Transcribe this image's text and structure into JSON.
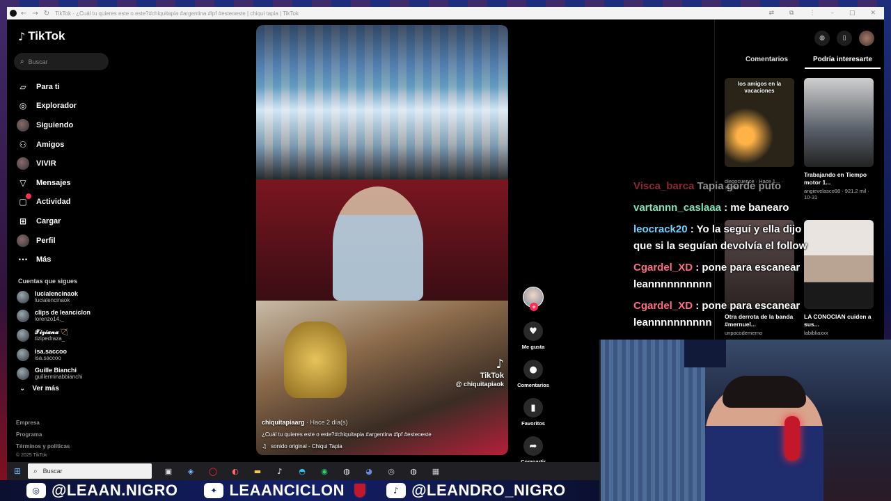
{
  "browser": {
    "tab_title": "TikTok - ¿Cuál tu quieres este o este?#chiquitapia #argentina #lpf #esteoeste | chiqui tapia | TikTok"
  },
  "sidebar": {
    "logo": "TikTok",
    "search_placeholder": "Buscar",
    "nav": [
      {
        "label": "Para ti",
        "icon": "home-icon"
      },
      {
        "label": "Explorador",
        "icon": "compass-icon"
      },
      {
        "label": "Siguiendo",
        "icon": "following-avatar-icon"
      },
      {
        "label": "Amigos",
        "icon": "friends-icon"
      },
      {
        "label": "VIVIR",
        "icon": "live-avatar-icon"
      },
      {
        "label": "Mensajes",
        "icon": "paper-plane-icon"
      },
      {
        "label": "Actividad",
        "icon": "activity-icon"
      },
      {
        "label": "Cargar",
        "icon": "upload-icon"
      },
      {
        "label": "Perfil",
        "icon": "profile-avatar-icon"
      },
      {
        "label": "Más",
        "icon": "more-icon"
      }
    ],
    "following_title": "Cuentas que sigues",
    "following": [
      {
        "name": "lucialencinaok",
        "handle": "lucialencinaok"
      },
      {
        "name": "clips de leanciclon",
        "handle": "lorenzo14._"
      },
      {
        "name": "𝓣𝓲𝔃𝓲𝓪𝓷𝓪 🏹",
        "handle": "tizipedraza_"
      },
      {
        "name": "isa.saccoo",
        "handle": "isa.saccoo"
      },
      {
        "name": "Guille Bianchi",
        "handle": "guillerminabbianchi"
      }
    ],
    "see_more": "Ver más",
    "footer": {
      "company": "Empresa",
      "program": "Programa",
      "terms": "Términos y políticas",
      "copyright": "© 2025 TikTok"
    }
  },
  "video": {
    "watermark_brand": "TikTok",
    "watermark_handle": "@ chiquitapiaok",
    "author": "chiquitapiaarg",
    "posted": "· Hace 2 día(s)",
    "description": "¿Cuál tu quieres este o este?#chiquitapia #argentina #lpf #esteoeste",
    "sound": "sonido original - Chiqui Tapia"
  },
  "actions": {
    "like": "Me gusta",
    "comments": "Comentarios",
    "favorites": "Favoritos",
    "share": "Compartir"
  },
  "right_panel": {
    "tabs": [
      "Comentarios",
      "Podría interesarte"
    ],
    "active_tab": 1,
    "cards": [
      {
        "caption": "los amigos en la vacaciones",
        "title": "",
        "meta": "diegocuence · Hace 1... · 32.5K",
        "bg": "#2a2418"
      },
      {
        "caption": "",
        "title": "Trabajando en Tiempo motor 1...",
        "meta": "angievelasco98 · 921.2 mil · 10-31",
        "bg": "#565c66"
      },
      {
        "caption": "",
        "title": "Otra derrota de la banda #mernuel...",
        "meta": "unpocodemerno",
        "bg": "#3b3030"
      },
      {
        "caption": "",
        "title": "LA CONOCIAN cuiden a sus...",
        "meta": "labibliaxxx",
        "bg": "#b9a493"
      }
    ]
  },
  "chat": [
    {
      "user": "Visca_barca",
      "text": "Tapia gorde puto",
      "color": "red",
      "faded": true
    },
    {
      "user": "vartannn_caslaaa",
      "text": ": me banearo",
      "color": "green",
      "faded": false
    },
    {
      "user": "leocrack20",
      "text": ": Yo la seguí y ella dijo que si la seguían devolvía el follow",
      "color": "blue",
      "faded": false
    },
    {
      "user": "Cgardel_XD",
      "text": ": pone para escanear leannnnnnnnnn",
      "color": "pink",
      "faded": false
    },
    {
      "user": "Cgardel_XD",
      "text": ": pone para escanear leannnnnnnnnn",
      "color": "pink",
      "faded": false
    }
  ],
  "taskbar": {
    "search_placeholder": "Buscar"
  },
  "social": {
    "instagram": "@LEAAN.NIGRO",
    "twitter": "LEAANCICLON",
    "tiktok": "@LEANDRO_NIGRO"
  }
}
